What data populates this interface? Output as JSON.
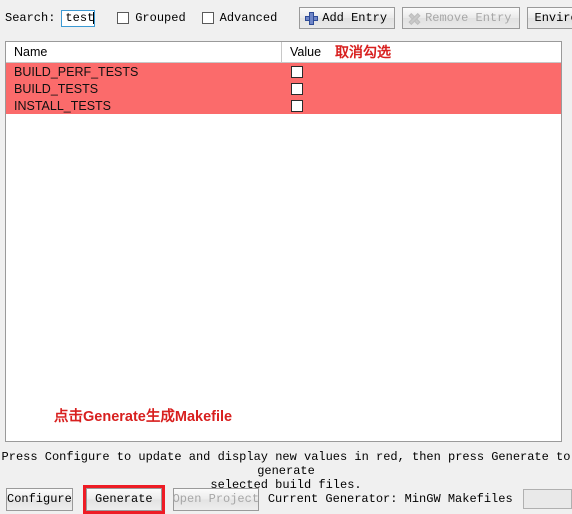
{
  "toolbar": {
    "search_label": "Search:",
    "search_value": "test",
    "search_placeholder": "",
    "grouped_label": "Grouped",
    "advanced_label": "Advanced",
    "add_entry_label": "Add Entry",
    "remove_entry_label": "Remove Entry",
    "environment_label": "Environment..."
  },
  "table": {
    "columns": {
      "name": "Name",
      "value": "Value"
    },
    "header_annotation": "取消勾选",
    "rows": [
      {
        "name": "BUILD_PERF_TESTS",
        "value_checked": false
      },
      {
        "name": "BUILD_TESTS",
        "value_checked": false
      },
      {
        "name": "INSTALL_TESTS",
        "value_checked": false
      }
    ],
    "bottom_annotation": "点击Generate生成Makefile"
  },
  "status": {
    "line1": "Press Configure to update and display new values in red, then press Generate to generate",
    "line2": "selected build files."
  },
  "bottombar": {
    "configure_label": "Configure",
    "generate_label": "Generate",
    "open_project_label": "Open Project",
    "generator_label": "Current Generator: MinGW Makefiles",
    "generator_value": ""
  },
  "colors": {
    "modified_row": "#fb6b6b",
    "annotation_red": "#d8201f",
    "highlight_border": "#ee1c25",
    "accent_blue": "#3c9ad4"
  }
}
